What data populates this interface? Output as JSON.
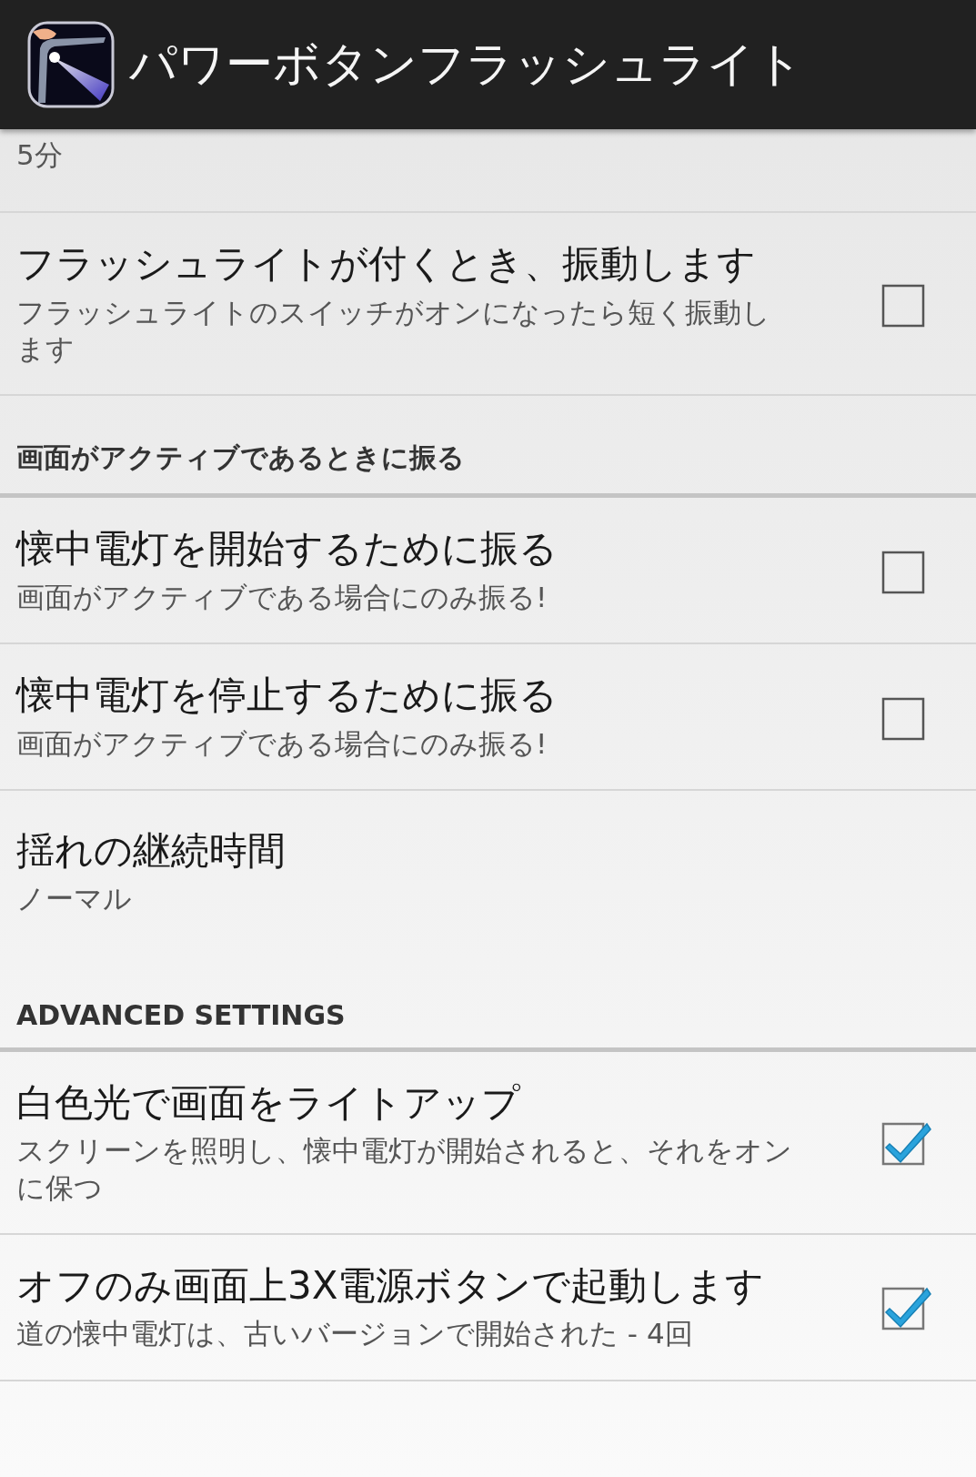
{
  "action_bar": {
    "title": "パワーボタンフラッシュライト"
  },
  "items": [
    {
      "kind": "summary",
      "summary": "5分"
    },
    {
      "kind": "checkbox",
      "title": "フラッシュライトが付くとき、振動します",
      "summary": "フラッシュライトのスイッチがオンになったら短く振動します",
      "checked": false
    },
    {
      "kind": "category",
      "title": "画面がアクティブであるときに振る"
    },
    {
      "kind": "checkbox",
      "title": "懐中電灯を開始するために振る",
      "summary": "画面がアクティブである場合にのみ振る!",
      "checked": false
    },
    {
      "kind": "checkbox",
      "title": "懐中電灯を停止するために振る",
      "summary": "画面がアクティブである場合にのみ振る!",
      "checked": false
    },
    {
      "kind": "list",
      "title": "揺れの継続時間",
      "summary": "ノーマル"
    },
    {
      "kind": "category",
      "title": "ADVANCED SETTINGS"
    },
    {
      "kind": "checkbox",
      "title": "白色光で画面をライトアップ",
      "summary": "スクリーンを照明し、懐中電灯が開始されると、それをオンに保つ",
      "checked": true
    },
    {
      "kind": "checkbox",
      "title": "オフのみ画面上3X電源ボタンで起動します",
      "summary": "道の懐中電灯は、古いバージョンで開始された - 4回",
      "checked": true
    }
  ]
}
